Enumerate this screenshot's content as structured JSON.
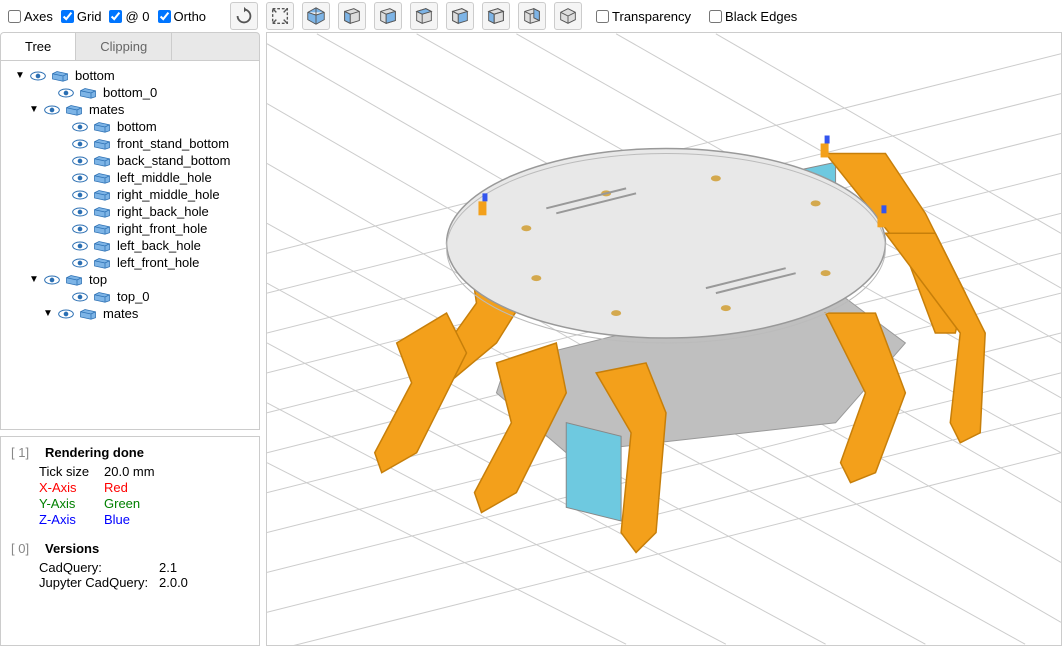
{
  "toolbar": {
    "axes": {
      "label": "Axes",
      "checked": false
    },
    "grid": {
      "label": "Grid",
      "checked": true
    },
    "at0": {
      "label": "@ 0",
      "checked": true
    },
    "ortho": {
      "label": "Ortho",
      "checked": true
    },
    "transparency": {
      "label": "Transparency",
      "checked": false
    },
    "black_edges": {
      "label": "Black Edges",
      "checked": false
    }
  },
  "tabs": {
    "tree": "Tree",
    "clipping": "Clipping"
  },
  "tree": {
    "items": [
      {
        "indent": 1,
        "expand": "▼",
        "label": "bottom"
      },
      {
        "indent": 3,
        "label": "bottom_0"
      },
      {
        "indent": 2,
        "expand": "▼",
        "label": "mates"
      },
      {
        "indent": 4,
        "label": "bottom"
      },
      {
        "indent": 4,
        "label": "front_stand_bottom"
      },
      {
        "indent": 4,
        "label": "back_stand_bottom"
      },
      {
        "indent": 4,
        "label": "left_middle_hole"
      },
      {
        "indent": 4,
        "label": "right_middle_hole"
      },
      {
        "indent": 4,
        "label": "right_back_hole"
      },
      {
        "indent": 4,
        "label": "right_front_hole"
      },
      {
        "indent": 4,
        "label": "left_back_hole"
      },
      {
        "indent": 4,
        "label": "left_front_hole"
      },
      {
        "indent": 2,
        "expand": "▼",
        "label": "top"
      },
      {
        "indent": 4,
        "label": "top_0"
      },
      {
        "indent": 3,
        "expand": "▼",
        "label": "mates"
      }
    ]
  },
  "info": {
    "r_idx": "[ 1]",
    "rendering": "Rendering done",
    "tick_label": "Tick size",
    "tick_val": "20.0 mm",
    "x_label": "X-Axis",
    "x_val": "Red",
    "y_label": "Y-Axis",
    "y_val": "Green",
    "z_label": "Z-Axis",
    "z_val": "Blue",
    "v_idx": "[ 0]",
    "versions": "Versions",
    "cq_label": "CadQuery:",
    "cq_val": "2.1",
    "jcq_label": "Jupyter CadQuery:",
    "jcq_val": "2.0.0"
  }
}
